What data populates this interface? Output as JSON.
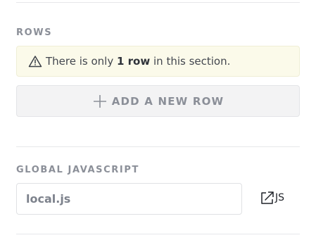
{
  "rows_section": {
    "label": "ROWS",
    "notice": {
      "icon": "warning-icon",
      "text_before": "There is only",
      "text_bold": "1 row",
      "text_after": "in this section."
    },
    "add_button": {
      "icon": "plus-icon",
      "label": "ADD A NEW ROW"
    }
  },
  "js_section": {
    "label": "GLOBAL JAVASCRIPT",
    "input_value": "local.js",
    "open_link": {
      "icon": "external-link-icon",
      "label": "JS"
    }
  }
}
